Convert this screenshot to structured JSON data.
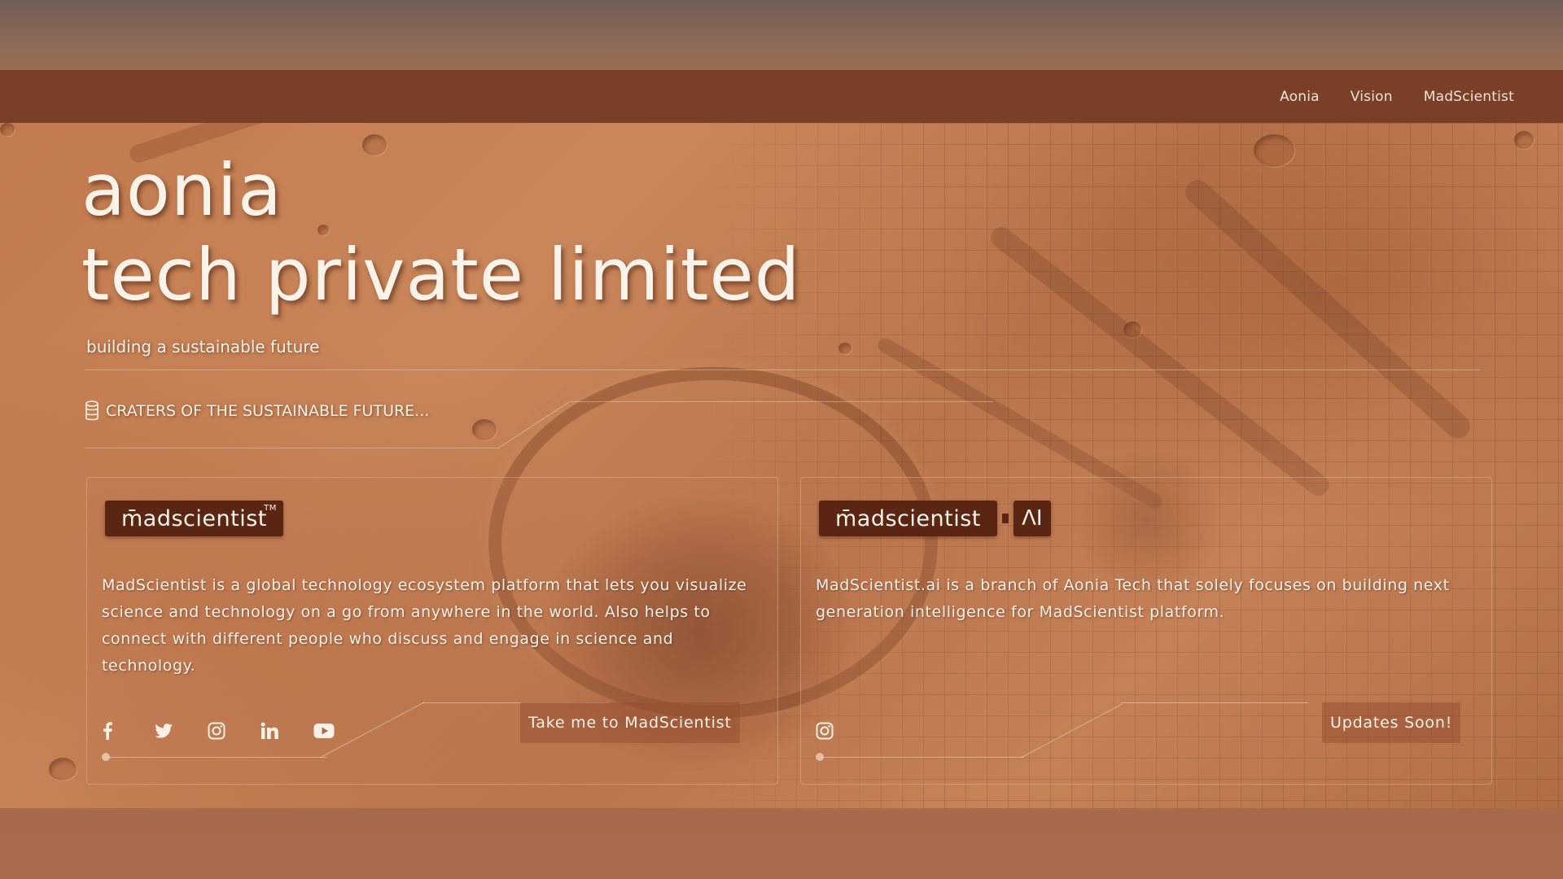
{
  "nav": {
    "links": [
      "Aonia",
      "Vision",
      "MadScientist"
    ]
  },
  "hero": {
    "title_line1": "aonia",
    "title_line2": "tech private limited",
    "subtitle": "building a sustainable future",
    "section_heading": "CRATERS OF THE SUSTAINABLE FUTURE..."
  },
  "cards": [
    {
      "logo_text": "m̄adscientist",
      "logo_tm": "TM",
      "description": "MadScientist is a global technology ecosystem platform that lets you visualize science and technology on a go from anywhere in the world. Also helps to connect with different people who discuss and engage in science and technology.",
      "socials": [
        "facebook-icon",
        "twitter-icon",
        "instagram-icon",
        "linkedin-icon",
        "youtube-icon"
      ],
      "cta_label": "Take me to MadScientist"
    },
    {
      "logo_text": "m̄adscientist",
      "logo_ai": "ΛI",
      "description": "MadScientist.ai is a branch of Aonia Tech that solely focuses on building next generation intelligence for MadScientist platform.",
      "socials": [
        "instagram-icon"
      ],
      "cta_label": "Updates Soon!"
    }
  ],
  "colors": {
    "navbar": "#7a3f27",
    "logo_bg": "#5a2513",
    "text": "#fbf0e6"
  }
}
